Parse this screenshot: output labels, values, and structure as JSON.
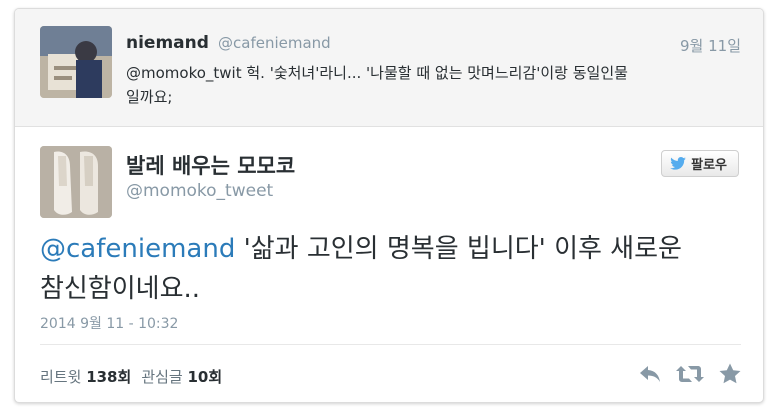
{
  "reply_to": {
    "name": "niemand",
    "handle": "@cafeniemand",
    "date": "9월 11일",
    "text_line1": "@momoko_twit 헉. '숯처녀'라니... '나물할 때 없는 맛며느리감'이랑 동일인물",
    "text_line2": "일까요;"
  },
  "tweet": {
    "name": "발레 배우는 모모코",
    "handle": "@momoko_tweet",
    "follow_label": "팔로우",
    "mention": "@cafeniemand",
    "text_part1": " '삶과 고인의 명복을 빕니다' 이후 새로운",
    "text_line2": "참신함이네요..",
    "timestamp": "2014 9월 11 - 10:32"
  },
  "stats": {
    "retweet_label": "리트윗",
    "retweet_count": "138회",
    "favorite_label": "관심글",
    "favorite_count": "10회"
  },
  "colors": {
    "link": "#2b7bb9",
    "secondary_text": "#8899a6",
    "twitter_blue": "#55acee"
  },
  "icons": [
    "twitter-bird-icon",
    "reply-icon",
    "retweet-icon",
    "favorite-star-icon"
  ]
}
